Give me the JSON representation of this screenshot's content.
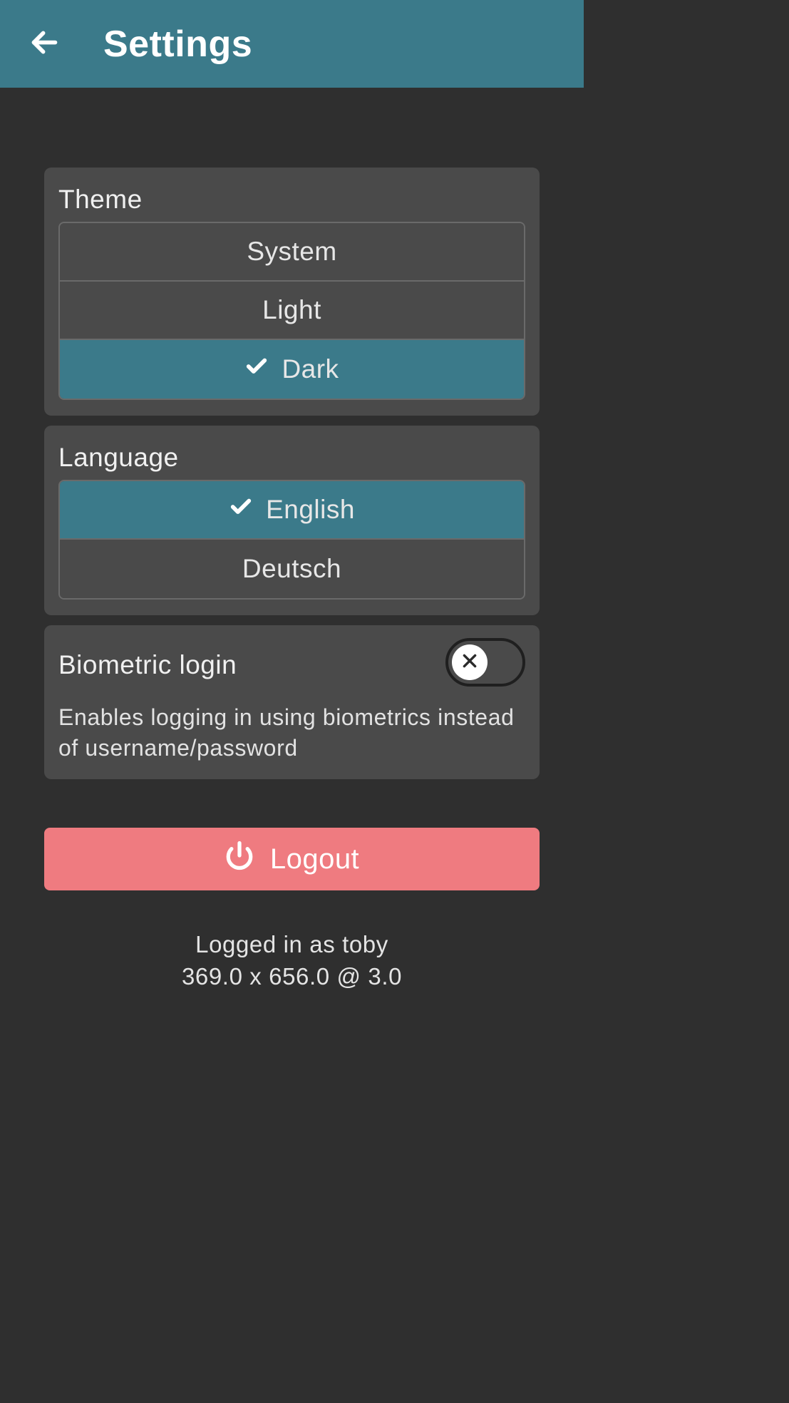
{
  "header": {
    "title": "Settings"
  },
  "theme": {
    "title": "Theme",
    "options": {
      "system": "System",
      "light": "Light",
      "dark": "Dark"
    },
    "selected": "dark"
  },
  "language": {
    "title": "Language",
    "options": {
      "english": "English",
      "deutsch": "Deutsch"
    },
    "selected": "english"
  },
  "biometric": {
    "title": "Biometric login",
    "enabled": false,
    "description": "Enables logging in using biometrics instead of username/password"
  },
  "logout": {
    "label": "Logout"
  },
  "footer": {
    "line1": "Logged in as toby",
    "line2": "369.0 x 656.0 @ 3.0"
  },
  "colors": {
    "header_bg": "#3b7a8a",
    "selected_bg": "#3b7a8a",
    "card_bg": "#4a4a4a",
    "page_bg": "#2f2f2f",
    "logout_bg": "#ef7b80"
  }
}
